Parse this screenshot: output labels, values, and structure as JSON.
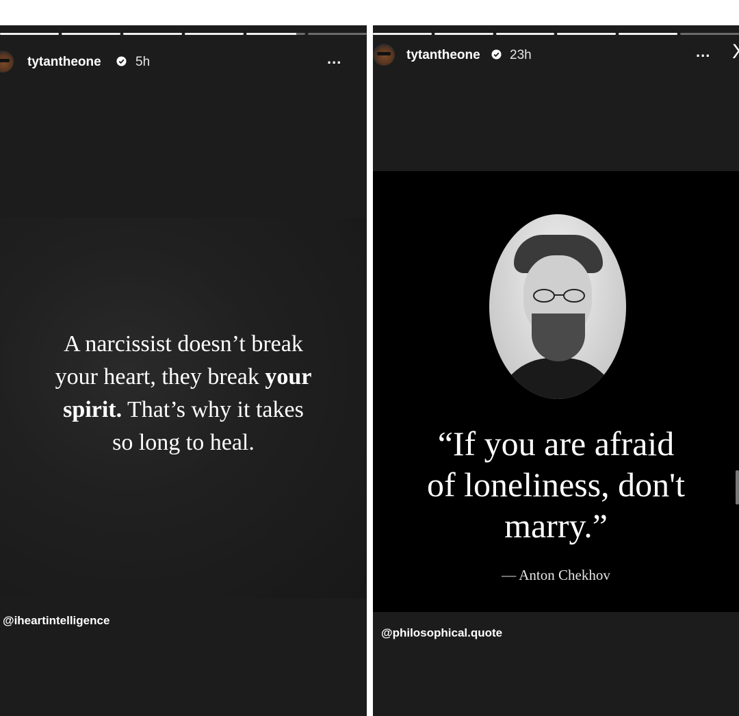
{
  "left_story": {
    "progress": [
      1,
      1,
      1,
      1,
      0.85,
      0
    ],
    "username": "tytantheone",
    "time": "5h",
    "more": "...",
    "quote_parts": [
      {
        "text": "A narcissist doesn’t break",
        "bold": false
      },
      {
        "text": "your heart, they break ",
        "bold": false
      },
      {
        "text": "your",
        "bold": true
      },
      {
        "text": "spirit.",
        "bold": true
      },
      {
        "text": " That’s why it takes",
        "bold": false
      },
      {
        "text": "so long to heal.",
        "bold": false
      }
    ],
    "handle": "@iheartintelligence"
  },
  "right_story": {
    "progress": [
      1,
      1,
      1,
      1,
      1,
      0
    ],
    "username": "tytantheone",
    "time": "23h",
    "more": "...",
    "close": "X",
    "quote_lines": [
      "“If you are afraid",
      "of loneliness, don't",
      "marry.”"
    ],
    "author": "— Anton Chekhov",
    "handle": "@philosophical.quote"
  }
}
